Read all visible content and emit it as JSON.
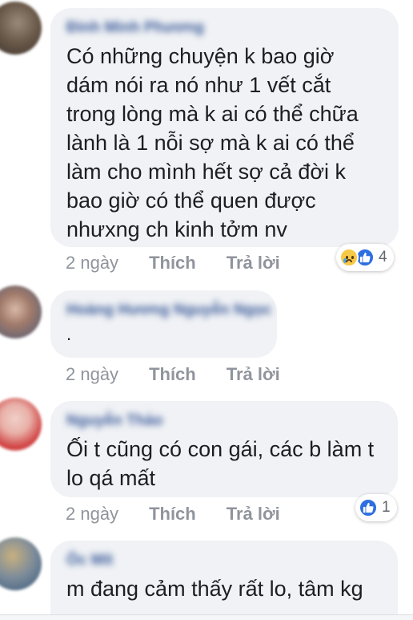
{
  "colors": {
    "bubble": "#f0f2f5",
    "author": "#385898",
    "text": "#1c1e21",
    "meta": "#90949c",
    "like_blue": "#2e6fe0",
    "sad_yellow": "#f7c948"
  },
  "comments": [
    {
      "author": "Đinh Minh Phương",
      "text": "Có những chuyện k bao giờ\ndám nói ra nó như 1 vết cắt\ntrong lòng mà k ai có thể chữa\nlành là 1 nỗi sợ mà k ai có thể\nlàm cho mình hết sợ cả đời k\nbao giờ có thể quen được\nnhưxng ch kinh tởm nv",
      "time": "2 ngày",
      "like": "Thích",
      "reply": "Trả lời",
      "reactions": {
        "icons": [
          "sad-icon",
          "like-icon"
        ],
        "count": "4"
      }
    },
    {
      "author": "Hoàng Hương Nguyễn Ngọc",
      "text": ".",
      "time": "2 ngày",
      "like": "Thích",
      "reply": "Trả lời"
    },
    {
      "author": "Nguyễn Thảo",
      "text": "Ối t cũng có con gái, các b làm t\nlo qá mất",
      "time": "2 ngày",
      "like": "Thích",
      "reply": "Trả lời",
      "reactions": {
        "icons": [
          "like-icon"
        ],
        "count": "1"
      }
    },
    {
      "author": "Ốc Mít",
      "text": "m đang cảm thấy rất lo, tâm kg"
    }
  ]
}
